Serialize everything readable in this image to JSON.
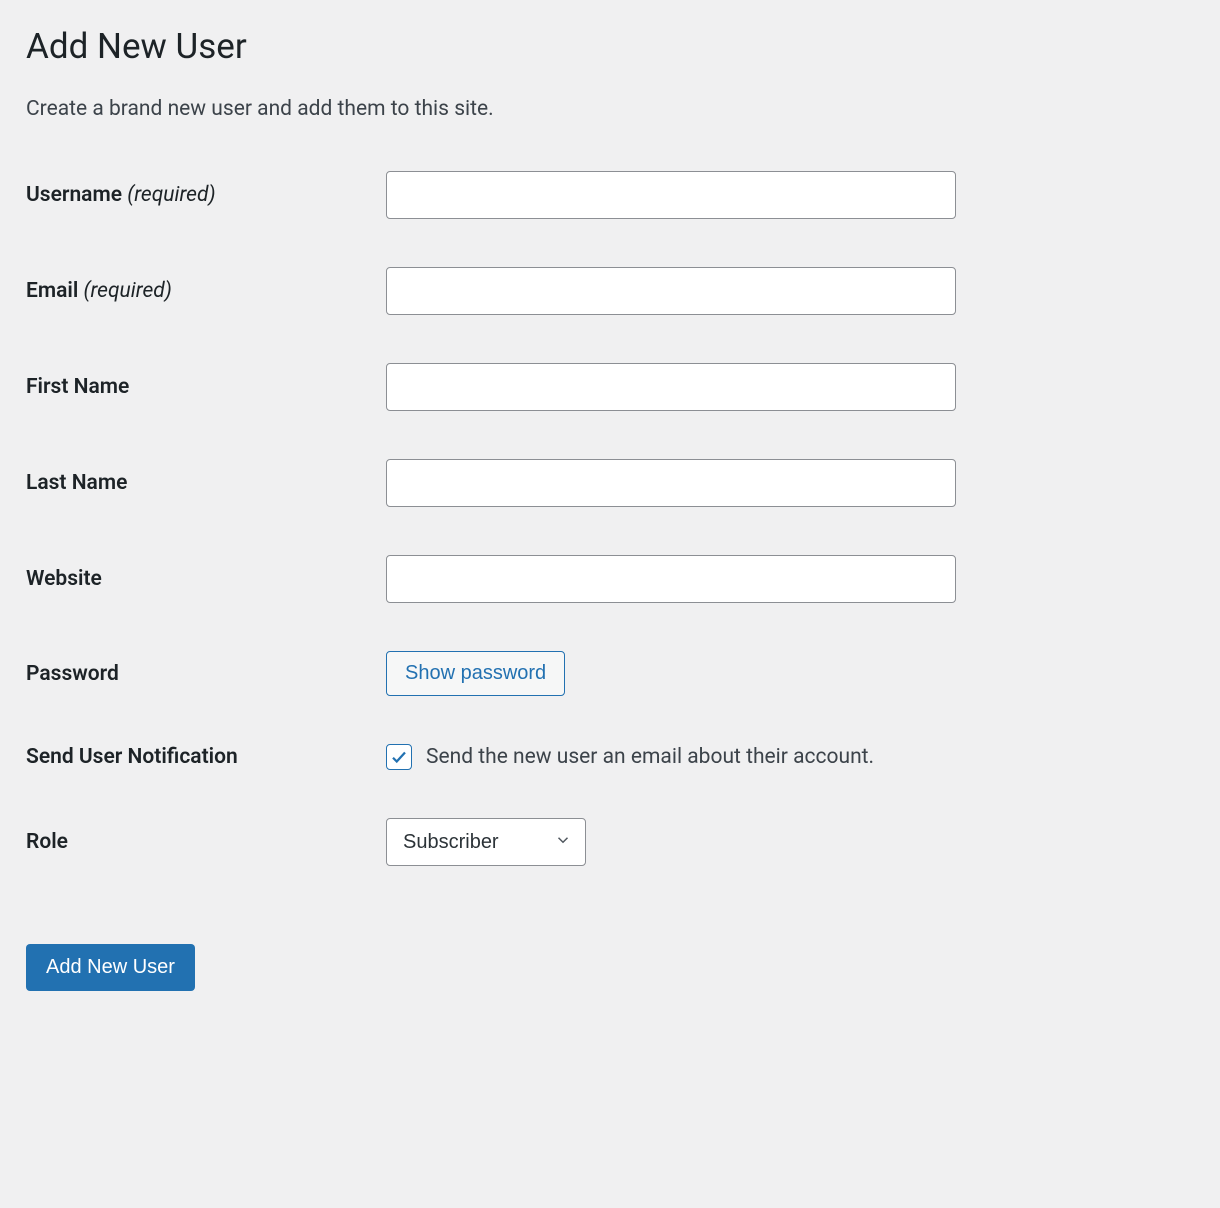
{
  "page": {
    "title": "Add New User",
    "subtitle": "Create a brand new user and add them to this site."
  },
  "form": {
    "username": {
      "label": "Username ",
      "required": "(required)",
      "value": ""
    },
    "email": {
      "label": "Email ",
      "required": "(required)",
      "value": ""
    },
    "first_name": {
      "label": "First Name",
      "value": ""
    },
    "last_name": {
      "label": "Last Name",
      "value": ""
    },
    "website": {
      "label": "Website",
      "value": ""
    },
    "password": {
      "label": "Password",
      "button": "Show password"
    },
    "notification": {
      "label": "Send User Notification",
      "checkbox_label": "Send the new user an email about their account.",
      "checked": true
    },
    "role": {
      "label": "Role",
      "selected": "Subscriber"
    }
  },
  "submit": {
    "label": "Add New User"
  }
}
